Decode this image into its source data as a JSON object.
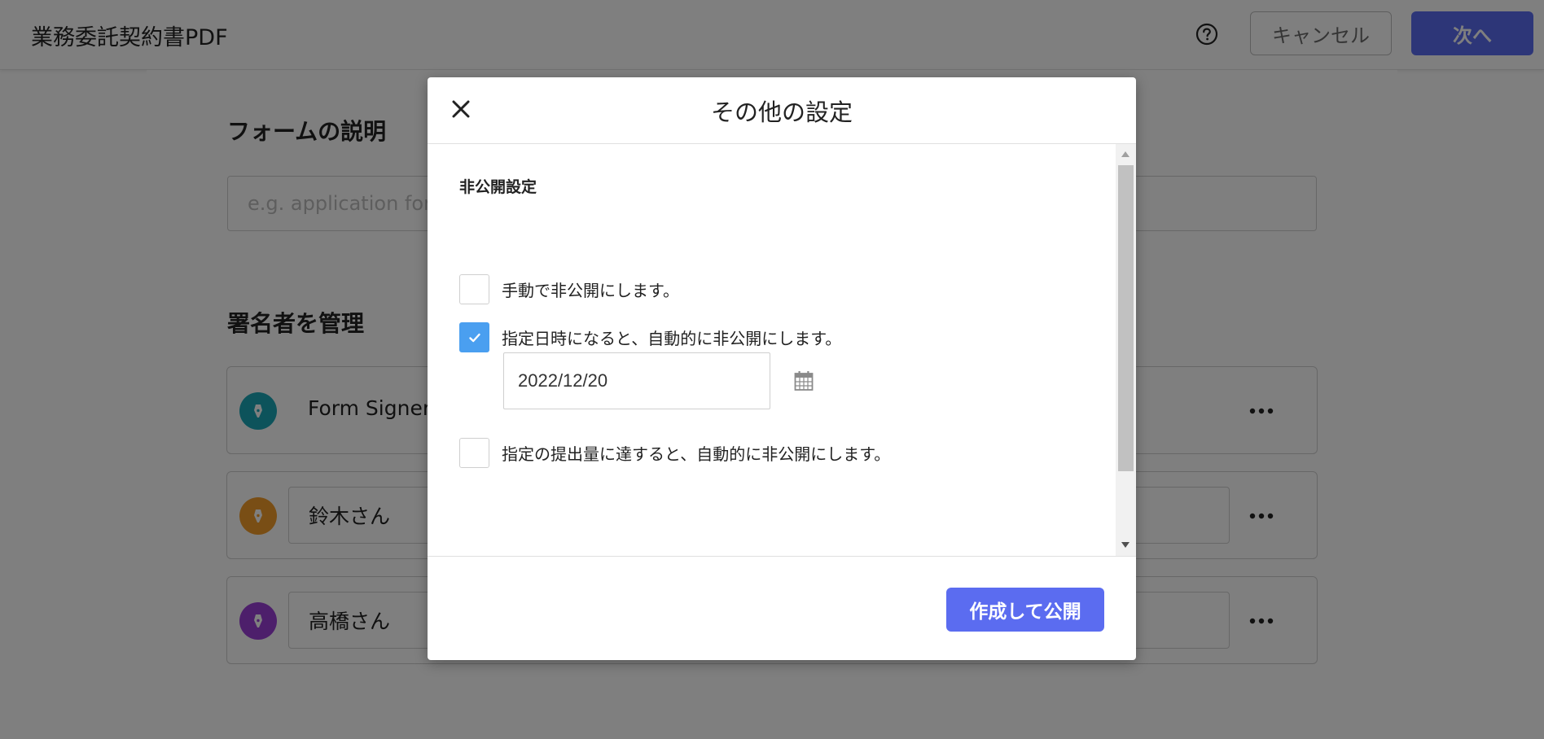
{
  "header": {
    "document_title": "業務委託契約書PDF",
    "help_icon": "question-circle-icon",
    "cancel_label": "キャンセル",
    "next_label": "次へ"
  },
  "main": {
    "description_section": {
      "title": "フォームの説明",
      "placeholder": "e.g. application form"
    },
    "signers_section": {
      "title": "署名者を管理",
      "signers": [
        {
          "name": "Form Signer",
          "avatar_color": "#1aa6b7",
          "icon": "pen-icon",
          "more_icon": "more-horizontal-icon"
        },
        {
          "name": "鈴木さん",
          "avatar_color": "#f39c2b",
          "icon": "pen-icon",
          "more_icon": "more-horizontal-icon"
        },
        {
          "name": "高橋さん",
          "avatar_color": "#9b3fd6",
          "icon": "pen-icon",
          "more_icon": "more-horizontal-icon"
        }
      ]
    }
  },
  "modal": {
    "title": "その他の設定",
    "close_icon": "close-icon",
    "group_label": "非公開設定",
    "options": [
      {
        "label": "手動で非公開にします。",
        "checked": false
      },
      {
        "label": "指定日時になると、自動的に非公開にします。",
        "checked": true
      },
      {
        "label": "指定の提出量に達すると、自動的に非公開にします。",
        "checked": false
      }
    ],
    "date_value": "2022/12/20",
    "calendar_icon": "calendar-icon",
    "publish_label": "作成して公開"
  },
  "colors": {
    "primary_button": "#5b6cf0",
    "checkbox_checked": "#4a9ff0",
    "overlay": "rgba(0,0,0,0.5)"
  }
}
